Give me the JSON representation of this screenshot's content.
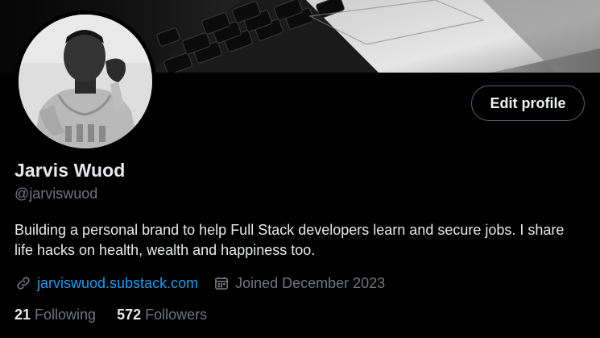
{
  "profile": {
    "name": "Jarvis Wuod",
    "handle": "@jarviswuod",
    "bio": "Building a personal brand to help Full Stack developers learn and secure jobs. I share life hacks on health, wealth and happiness too.",
    "website": "jarviswuod.substack.com",
    "joined": "Joined December 2023",
    "following_count": "21",
    "following_label": "Following",
    "followers_count": "572",
    "followers_label": "Followers"
  },
  "actions": {
    "edit_profile_label": "Edit profile"
  },
  "icons": {
    "website": "link-icon",
    "joined": "calendar-icon"
  },
  "colors": {
    "background": "#000000",
    "link": "#1d9bf0",
    "secondary_text": "#71767b",
    "primary_text": "#e7e9ea",
    "button_border": "#536471"
  }
}
